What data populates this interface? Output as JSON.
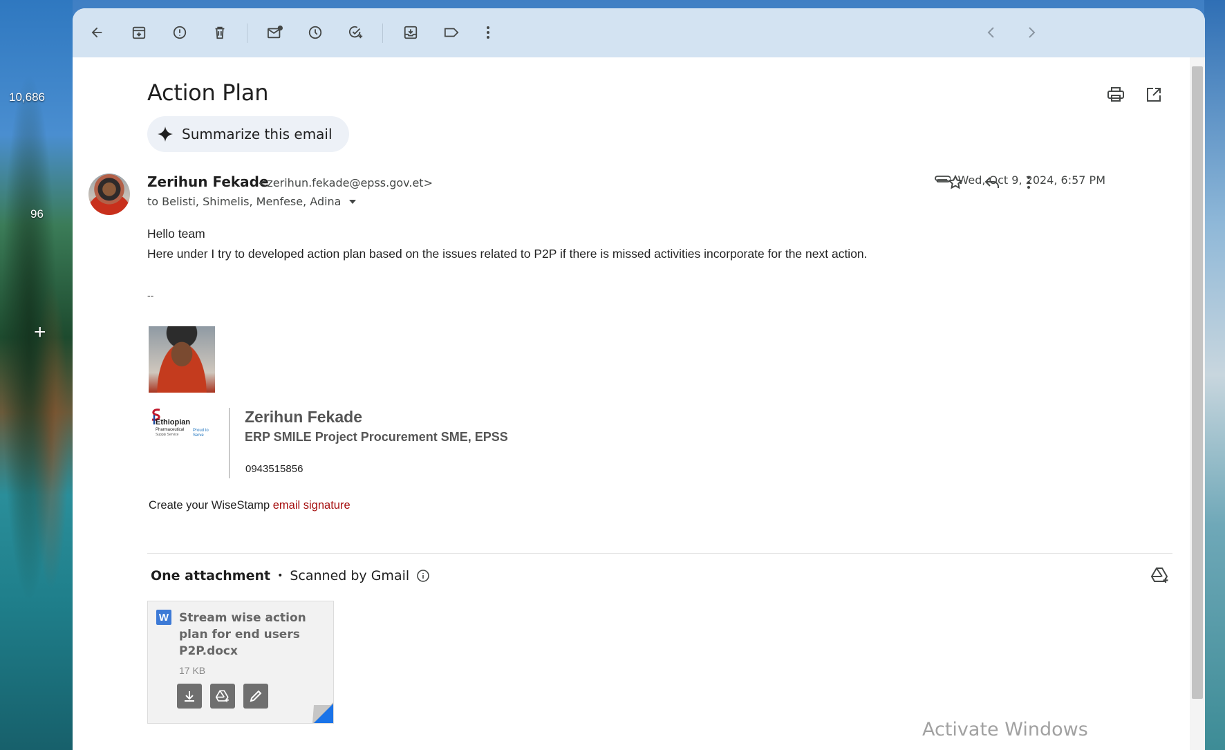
{
  "desktop": {
    "counter_top": "10,686",
    "counter_mid": "96",
    "plus": "+"
  },
  "toolbar": {
    "icons": [
      "back-icon",
      "archive-icon",
      "report-spam-icon",
      "delete-icon",
      "mark-unread-icon",
      "snooze-icon",
      "add-task-icon",
      "move-to-icon",
      "label-icon",
      "more-icon",
      "prev-icon",
      "next-icon"
    ]
  },
  "email": {
    "subject": "Action Plan",
    "summarize_label": "Summarize this email",
    "sender_name": "Zerihun Fekade",
    "sender_email": "<zerihun.fekade@epss.gov.et>",
    "recipients": "to Belisti, Shimelis, Menfese, Adina",
    "date": "Wed, Oct 9, 2024, 6:57 PM",
    "greeting": "Hello team",
    "body": "Here under I try to developed action plan based on the issues related to P2P if there is missed activities incorporate for the next action.",
    "sig_separator": "--"
  },
  "signature": {
    "logo_title": "Ethiopian",
    "logo_sub": "Pharmaceutical",
    "logo_sub2": "Supply Service",
    "logo_tag": "Proud to Serve",
    "name": "Zerihun Fekade",
    "title": "ERP SMILE Project Procurement SME, EPSS",
    "phone": "0943515856",
    "wisestamp_prefix": "Create your WiseStamp ",
    "wisestamp_link": "email signature"
  },
  "attachments": {
    "header": "One attachment",
    "scanned": "Scanned by Gmail",
    "items": [
      {
        "icon": "W",
        "name": "Stream wise action plan for end users P2P.docx",
        "size": "17 KB"
      }
    ]
  },
  "watermark": "Activate Windows",
  "colors": {
    "toolbar_bg": "#d3e3f2",
    "link_red": "#a50e0e",
    "word_blue": "#3d7ad6"
  }
}
